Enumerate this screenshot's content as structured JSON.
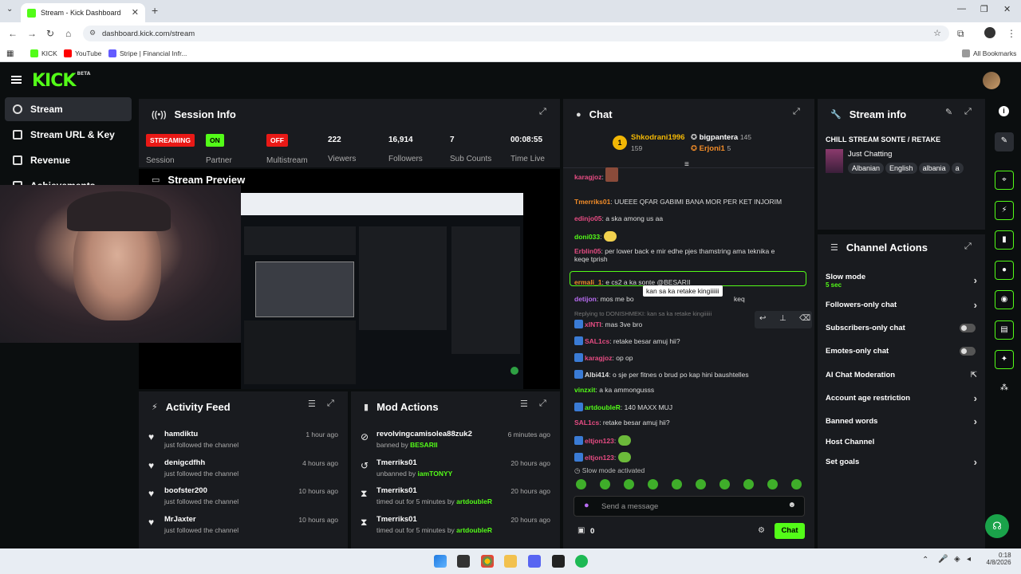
{
  "browser": {
    "tab_title": "Stream - Kick Dashboard",
    "url": "dashboard.kick.com/stream",
    "bookmarks": [
      "KICK",
      "YouTube",
      "Stripe | Financial Infr..."
    ],
    "all_bookmarks": "All Bookmarks"
  },
  "app": {
    "logo": "KICK",
    "logo_sup": "BETA"
  },
  "sidebar": {
    "items": [
      {
        "label": "Stream"
      },
      {
        "label": "Stream URL & Key"
      },
      {
        "label": "Revenue"
      },
      {
        "label": "Achievements"
      }
    ]
  },
  "session": {
    "title": "Session Info",
    "stats": [
      {
        "value": "STREAMING",
        "label": "Session",
        "color": "#e91916"
      },
      {
        "value": "ON",
        "label": "Partner",
        "color": "#53fc18"
      },
      {
        "value": "OFF",
        "label": "Multistream",
        "color": "#e91916"
      },
      {
        "value": "222",
        "label": "Viewers"
      },
      {
        "value": "16,914",
        "label": "Followers"
      },
      {
        "value": "7",
        "label": "Sub Counts"
      },
      {
        "value": "00:08:55",
        "label": "Time Live"
      }
    ]
  },
  "preview": {
    "title": "Stream Preview"
  },
  "activity": {
    "title": "Activity Feed",
    "items": [
      {
        "name": "hamdiktu",
        "sub": "just followed the channel",
        "time": "1 hour ago"
      },
      {
        "name": "denigcdfhh",
        "sub": "just followed the channel",
        "time": "4 hours ago"
      },
      {
        "name": "boofster200",
        "sub": "just followed the channel",
        "time": "10 hours ago"
      },
      {
        "name": "MrJaxter",
        "sub": "just followed the channel",
        "time": "10 hours ago"
      }
    ]
  },
  "mod": {
    "title": "Mod Actions",
    "items": [
      {
        "name": "revolvingcamisolea88zuk2",
        "sub": "banned by ",
        "by": "BESARII",
        "time": "6 minutes ago"
      },
      {
        "name": "Tmerriks01",
        "sub": "unbanned by ",
        "by": "iamTONYY",
        "time": "20 hours ago"
      },
      {
        "name": "Tmerriks01",
        "sub": "timed out for 5 minutes by ",
        "by": "artdoubleR",
        "time": "20 hours ago"
      },
      {
        "name": "Tmerriks01",
        "sub": "timed out for 5 minutes by ",
        "by": "artdoubleR",
        "time": "20 hours ago"
      }
    ]
  },
  "chat": {
    "title": "Chat",
    "leaderboard": [
      {
        "rank": "1",
        "name": "Shkodrani1996",
        "count": "159"
      },
      {
        "name": "bigpantera",
        "count": "145"
      },
      {
        "name": "Erjoni1",
        "count": "5"
      }
    ],
    "messages": [
      {
        "user": "karagjoz",
        "text": "",
        "color": "#e64c83"
      },
      {
        "user": "Tmerriks01",
        "text": "UUEEE QFAR GABIMI BANA MOR PER KET INJORIM",
        "color": "#f28c28"
      },
      {
        "user": "edinjo05",
        "text": "a ska among us aa",
        "color": "#e64c83"
      },
      {
        "user": "doni033",
        "text": "",
        "color": "#53fc18"
      },
      {
        "user": "Erblin05",
        "text": "per lower back e mir edhe pjes thamstring ama teknika e",
        "text2": "keqe tprish",
        "color": "#e64c83"
      },
      {
        "user": "ermali_1",
        "text": "e cs2 a ka sonte @BESARII",
        "color": "#f28c28"
      },
      {
        "user": "detijon",
        "text": "mos me bo",
        "text2": "keq",
        "color": "#b86cf2"
      },
      {
        "user": "xINTI",
        "text": "mas 3ve bro",
        "color": "#e64c83",
        "reply": "Replying to DONISHMEKI: kan sa ka retake kingiiiiii"
      },
      {
        "user": "SAL1cs",
        "text": "retake besar amuj hii?",
        "color": "#e64c83"
      },
      {
        "user": "karagjoz",
        "text": "op op",
        "color": "#e64c83"
      },
      {
        "user": "Albi414",
        "text": "o sje per fitnes o brud po kap hini baushtelles",
        "color": "#dddddd"
      },
      {
        "user": "vinzxit",
        "text": "a ka ammongusss",
        "color": "#53fc18"
      },
      {
        "user": "artdoubleR",
        "text": "140 MAXX MUJ",
        "color": "#53fc18"
      },
      {
        "user": "SAL1cs",
        "text": "retake besar amuj hii?",
        "color": "#e64c83"
      },
      {
        "user": "eltjon123",
        "text": "",
        "color": "#e64c83"
      },
      {
        "user": "eltjon123",
        "text": "",
        "color": "#e64c83"
      }
    ],
    "tooltip": "kan sa ka retake kingiiiiii",
    "slow_mode_note": "Slow mode activated",
    "input_placeholder": "Send a message",
    "points": "0",
    "send_label": "Chat"
  },
  "stream_info": {
    "title": "Stream info",
    "stream_title": "CHILL STREAM SONTE / RETAKE",
    "category": "Just Chatting",
    "tags": [
      "Albanian",
      "English",
      "albania",
      "a"
    ]
  },
  "channel_actions": {
    "title": "Channel Actions",
    "items": [
      {
        "label": "Slow mode",
        "sub": "5 sec",
        "control": "chevron"
      },
      {
        "label": "Followers-only chat",
        "control": "chevron"
      },
      {
        "label": "Subscribers-only chat",
        "control": "toggle"
      },
      {
        "label": "Emotes-only chat",
        "control": "toggle"
      },
      {
        "label": "AI Chat Moderation",
        "control": "external"
      },
      {
        "label": "Account age restriction",
        "control": "chevron"
      },
      {
        "label": "Banned words",
        "control": "chevron"
      },
      {
        "label": "Host Channel",
        "control": "none"
      },
      {
        "label": "Set goals",
        "control": "chevron"
      }
    ]
  },
  "taskbar": {
    "time": "0:18",
    "date": "4/8/2026"
  },
  "colors": {
    "accent": "#53fc18",
    "panel": "#191b1f",
    "bg": "#0b0e0f"
  }
}
